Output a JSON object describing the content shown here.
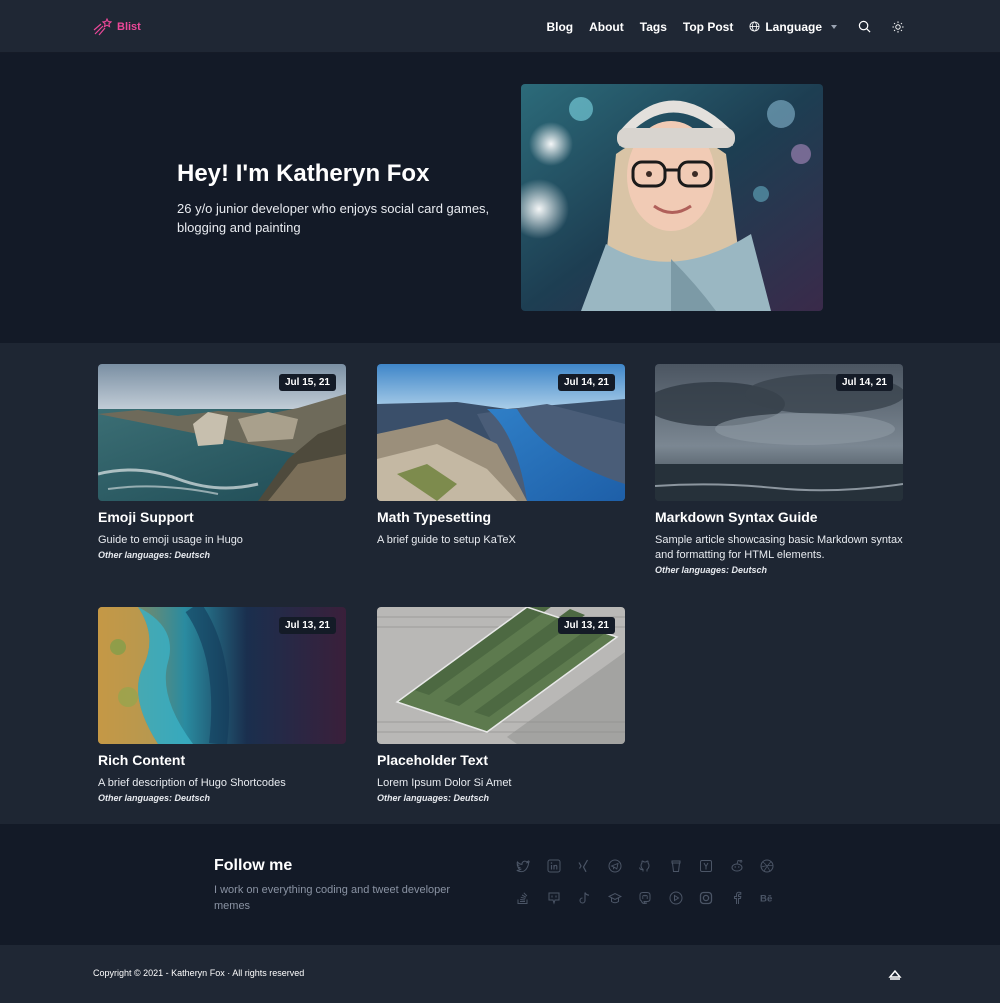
{
  "brand": {
    "name": "Blist",
    "color": "#ec4899"
  },
  "nav": {
    "links": [
      "Blog",
      "About",
      "Tags",
      "Top Post"
    ],
    "language_label": "Language",
    "icons": [
      "globe-icon",
      "chevron-down-icon",
      "search-icon",
      "sun-icon"
    ]
  },
  "hero": {
    "title": "Hey! I'm Katheryn Fox",
    "subtitle": "26 y/o junior developer who enjoys social card games, blogging and painting"
  },
  "posts": [
    {
      "title": "Emoji Support",
      "date": "Jul 15, 21",
      "description": "Guide to emoji usage in Hugo",
      "other_languages": "Other languages: Deutsch"
    },
    {
      "title": "Math Typesetting",
      "date": "Jul 14, 21",
      "description": "A brief guide to setup KaTeX",
      "other_languages": ""
    },
    {
      "title": "Markdown Syntax Guide",
      "date": "Jul 14, 21",
      "description": "Sample article showcasing basic Markdown syntax and formatting for HTML elements.",
      "other_languages": "Other languages: Deutsch"
    },
    {
      "title": "Rich Content",
      "date": "Jul 13, 21",
      "description": "A brief description of Hugo Shortcodes",
      "other_languages": "Other languages: Deutsch"
    },
    {
      "title": "Placeholder Text",
      "date": "Jul 13, 21",
      "description": "Lorem Ipsum Dolor Si Amet",
      "other_languages": "Other languages: Deutsch"
    }
  ],
  "follow": {
    "title": "Follow me",
    "subtitle": "I work on everything coding and tweet developer memes",
    "social_icons": [
      "twitter-icon",
      "linkedin-icon",
      "xing-icon",
      "telegram-icon",
      "github-icon",
      "coffee-icon",
      "hackernews-icon",
      "reddit-icon",
      "dribbble-icon",
      "stackoverflow-icon",
      "gitlab-icon",
      "tiktok-icon",
      "graduation-cap-icon",
      "mastodon-icon",
      "youtube-icon",
      "instagram-icon",
      "facebook-icon",
      "behance-icon"
    ],
    "icon_color": "#4b5566"
  },
  "footer": {
    "copyright": "Copyright © 2021 - Katheryn Fox · All rights reserved",
    "scroll_top_icon": "arrow-up-icon"
  }
}
